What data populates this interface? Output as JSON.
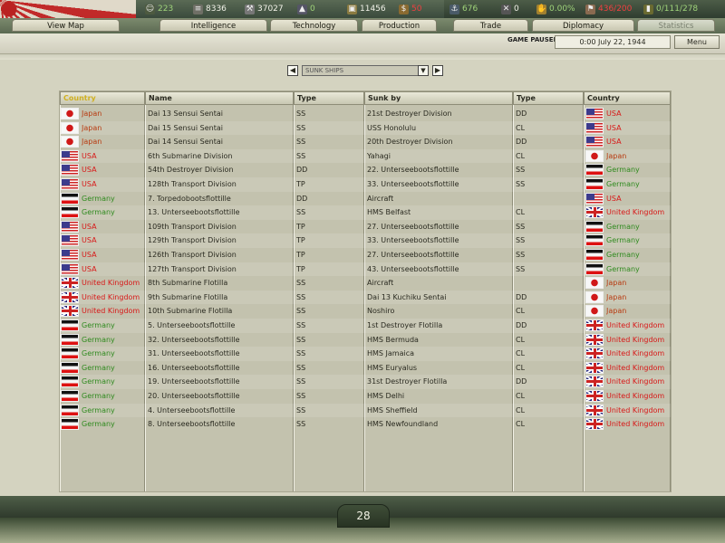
{
  "resources": {
    "manpower": "223",
    "energy": "8336",
    "metal": "37027",
    "oil": "0",
    "supplies": "11456",
    "money": "50",
    "transports": "676",
    "escorts": "0",
    "dissent": "0.00%",
    "mobilized": "436/200",
    "convoys": "0/111/278"
  },
  "tabs": [
    "View Map",
    "Intelligence",
    "Technology",
    "Production",
    "Trade",
    "Diplomacy",
    "Statistics"
  ],
  "status": {
    "paused_label": "GAME PAUSED",
    "date": "0:00 July 22, 1944",
    "menu_label": "Menu"
  },
  "selector": {
    "value": "SUNK SHIPS"
  },
  "columns": [
    "Country",
    "Name",
    "Type",
    "Sunk by",
    "Type",
    "Country"
  ],
  "rows": [
    {
      "c1": "Japan",
      "name": "Dai 13 Sensui Sentai",
      "t1": "SS",
      "by": "21st Destroyer Division",
      "t2": "DD",
      "c2": "USA"
    },
    {
      "c1": "Japan",
      "name": "Dai 15 Sensui Sentai",
      "t1": "SS",
      "by": "USS Honolulu",
      "t2": "CL",
      "c2": "USA"
    },
    {
      "c1": "Japan",
      "name": "Dai 14 Sensui Sentai",
      "t1": "SS",
      "by": "20th Destroyer Division",
      "t2": "DD",
      "c2": "USA"
    },
    {
      "c1": "USA",
      "name": "6th Submarine Division",
      "t1": "SS",
      "by": "Yahagi",
      "t2": "CL",
      "c2": "Japan"
    },
    {
      "c1": "USA",
      "name": "54th Destroyer Division",
      "t1": "DD",
      "by": "22. Unterseebootsflottille",
      "t2": "SS",
      "c2": "Germany"
    },
    {
      "c1": "USA",
      "name": "128th Transport Division",
      "t1": "TP",
      "by": "33. Unterseebootsflottille",
      "t2": "SS",
      "c2": "Germany"
    },
    {
      "c1": "Germany",
      "name": "7. Torpedobootsflottille",
      "t1": "DD",
      "by": "Aircraft",
      "t2": "",
      "c2": "USA"
    },
    {
      "c1": "Germany",
      "name": "13. Unterseebootsflottille",
      "t1": "SS",
      "by": "HMS Belfast",
      "t2": "CL",
      "c2": "United Kingdom"
    },
    {
      "c1": "USA",
      "name": "109th Transport Division",
      "t1": "TP",
      "by": "27. Unterseebootsflottille",
      "t2": "SS",
      "c2": "Germany"
    },
    {
      "c1": "USA",
      "name": "129th Transport Division",
      "t1": "TP",
      "by": "33. Unterseebootsflottille",
      "t2": "SS",
      "c2": "Germany"
    },
    {
      "c1": "USA",
      "name": "126th Transport Division",
      "t1": "TP",
      "by": "27. Unterseebootsflottille",
      "t2": "SS",
      "c2": "Germany"
    },
    {
      "c1": "USA",
      "name": "127th Transport Division",
      "t1": "TP",
      "by": "43. Unterseebootsflottille",
      "t2": "SS",
      "c2": "Germany"
    },
    {
      "c1": "United Kingdom",
      "name": "8th Submarine Flotilla",
      "t1": "SS",
      "by": "Aircraft",
      "t2": "",
      "c2": "Japan"
    },
    {
      "c1": "United Kingdom",
      "name": "9th Submarine Flotilla",
      "t1": "SS",
      "by": "Dai 13 Kuchiku Sentai",
      "t2": "DD",
      "c2": "Japan"
    },
    {
      "c1": "United Kingdom",
      "name": "10th Submarine Flotilla",
      "t1": "SS",
      "by": "Noshiro",
      "t2": "CL",
      "c2": "Japan"
    },
    {
      "c1": "Germany",
      "name": "5. Unterseebootsflottille",
      "t1": "SS",
      "by": "1st Destroyer Flotilla",
      "t2": "DD",
      "c2": "United Kingdom"
    },
    {
      "c1": "Germany",
      "name": "32. Unterseebootsflottille",
      "t1": "SS",
      "by": "HMS Bermuda",
      "t2": "CL",
      "c2": "United Kingdom"
    },
    {
      "c1": "Germany",
      "name": "31. Unterseebootsflottille",
      "t1": "SS",
      "by": "HMS Jamaica",
      "t2": "CL",
      "c2": "United Kingdom"
    },
    {
      "c1": "Germany",
      "name": "16. Unterseebootsflottille",
      "t1": "SS",
      "by": "HMS Euryalus",
      "t2": "CL",
      "c2": "United Kingdom"
    },
    {
      "c1": "Germany",
      "name": "19. Unterseebootsflottille",
      "t1": "SS",
      "by": "31st Destroyer Flotilla",
      "t2": "DD",
      "c2": "United Kingdom"
    },
    {
      "c1": "Germany",
      "name": "20. Unterseebootsflottille",
      "t1": "SS",
      "by": "HMS Delhi",
      "t2": "CL",
      "c2": "United Kingdom"
    },
    {
      "c1": "Germany",
      "name": "4. Unterseebootsflottille",
      "t1": "SS",
      "by": "HMS Sheffield",
      "t2": "CL",
      "c2": "United Kingdom"
    },
    {
      "c1": "Germany",
      "name": "8. Unterseebootsflottille",
      "t1": "SS",
      "by": "HMS Newfoundland",
      "t2": "CL",
      "c2": "United Kingdom"
    }
  ],
  "country_colors": {
    "Japan": "#b83a10",
    "USA": "#d81818",
    "Germany": "#2f8a1e",
    "United Kingdom": "#d81818"
  },
  "page_number": "28"
}
